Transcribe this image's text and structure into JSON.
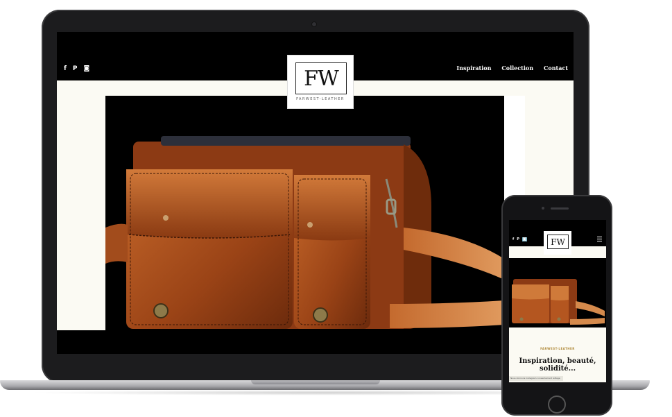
{
  "laptop": {
    "social_icons": [
      {
        "icon": "facebook-icon",
        "glyph": "f"
      },
      {
        "icon": "pinterest-icon",
        "glyph": "P"
      },
      {
        "icon": "instagram-icon",
        "glyph": "◙"
      }
    ],
    "logo": {
      "mark": "FW",
      "tagline": "FARWEST-LEATHER"
    },
    "nav": [
      "Inspiration",
      "Collection",
      "Contact"
    ],
    "hero_image": "leather-satchel-photo"
  },
  "phone": {
    "social_icons": [
      {
        "icon": "facebook-icon",
        "glyph": "f"
      },
      {
        "icon": "pinterest-icon",
        "glyph": "P"
      },
      {
        "icon": "instagram-icon",
        "glyph": "◙"
      }
    ],
    "logo": {
      "mark": "FW"
    },
    "menu_icon": "hamburger-icon",
    "tagline": "FARWEST-LEATHER",
    "heading": "Inspiration, beauté, solidité...",
    "cookie_text": "Nous donnons Instagram consentement lettage"
  },
  "colors": {
    "cream": "#fbfaf3",
    "leather": "#b5541e",
    "accent_gold": "#b08a3a"
  }
}
